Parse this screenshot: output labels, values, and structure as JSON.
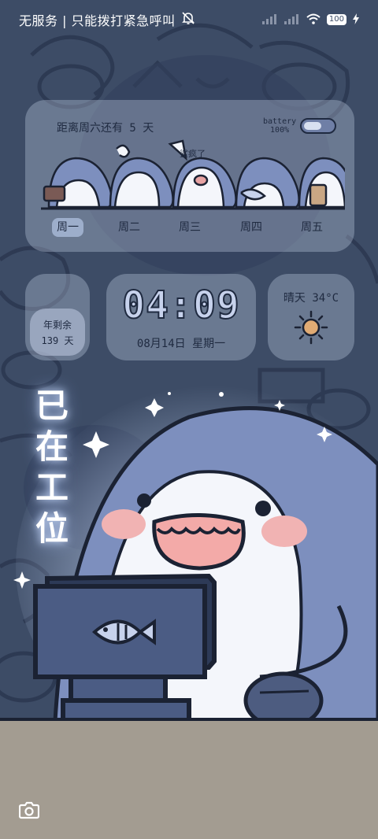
{
  "status_bar": {
    "carrier": "无服务 | 只能拨打紧急呼叫",
    "battery_level": "100",
    "icons": [
      "silent-bell-icon",
      "signal-icon",
      "signal-icon",
      "wifi-icon",
      "battery-icon",
      "charging-icon"
    ]
  },
  "week_widget": {
    "countdown": "距离周六还有 5 天",
    "battery_label": "battery",
    "battery_percent": "100%",
    "shark_note": "鲨疯了",
    "days": [
      "周一",
      "周二",
      "周三",
      "周四",
      "周五"
    ],
    "active_day": "周一"
  },
  "year_widget": {
    "label": "年剩余",
    "days": "139 天"
  },
  "clock_widget": {
    "time": "04:09",
    "date": "08月14日  星期一"
  },
  "weather_widget": {
    "text": "晴天 34°C",
    "icon": "sun-icon"
  },
  "wallpaper": {
    "vertical_text": [
      "已",
      "在",
      "工",
      "位"
    ],
    "icon": "fish-icon"
  },
  "lockscreen": {
    "camera_icon": "camera-icon"
  },
  "colors": {
    "background": "#3d4c66",
    "shark_blue": "#7d8fbe",
    "outline": "#1b2233",
    "floor": "#a39c91",
    "glow": "#cfe0ff"
  }
}
